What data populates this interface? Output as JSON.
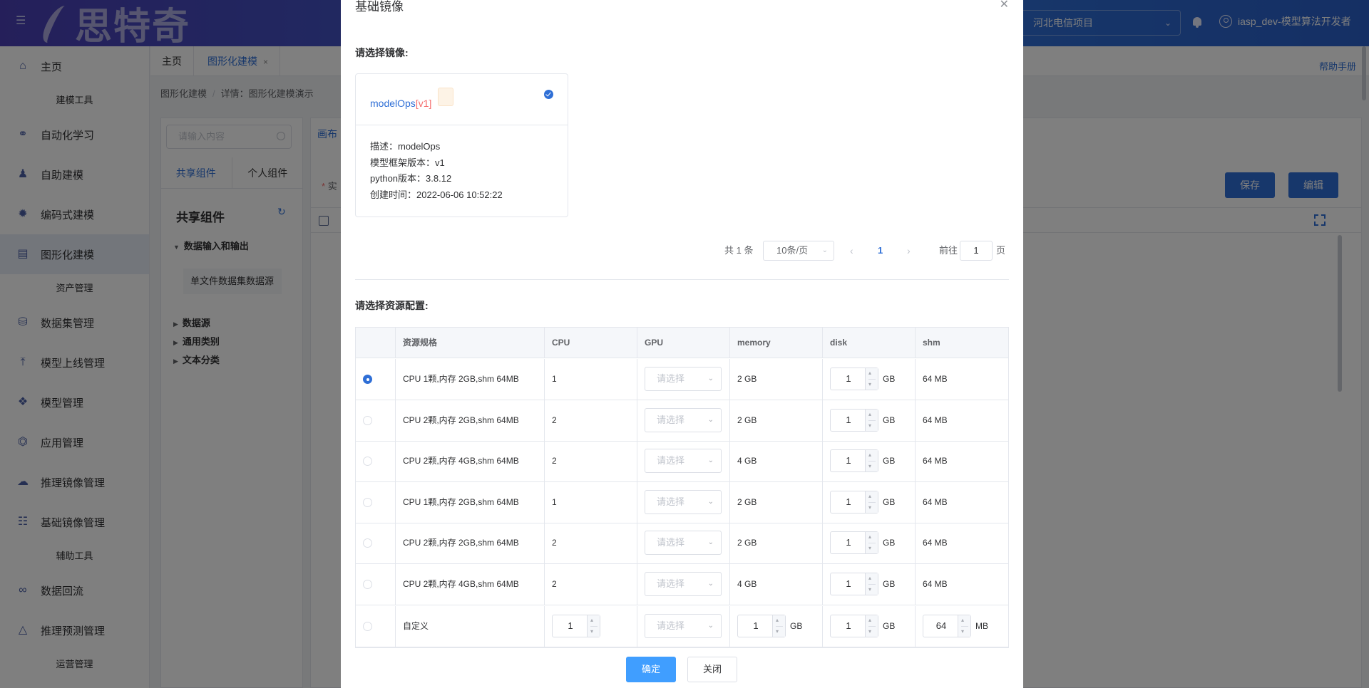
{
  "header": {
    "logo_text": "思特奇",
    "project": "河北电信项目",
    "user": "iasp_dev-模型算法开发者"
  },
  "sidebar": {
    "home": "主页",
    "group_modeling": "建模工具",
    "automl": "自动化学习",
    "self_modeling": "自助建模",
    "code_modeling": "编码式建模",
    "graph_modeling": "图形化建模",
    "group_assets": "资产管理",
    "dataset_mgmt": "数据集管理",
    "model_online": "模型上线管理",
    "model_mgmt": "模型管理",
    "app_mgmt": "应用管理",
    "infer_image_mgmt": "推理镜像管理",
    "base_image_mgmt": "基础镜像管理",
    "group_aux": "辅助工具",
    "data_backflow": "数据回流",
    "infer_predict_mgmt": "推理预测管理",
    "group_ops": "运营管理"
  },
  "tabs": {
    "home": "主页",
    "graph": "图形化建模",
    "help": "帮助手册"
  },
  "breadcrumb": {
    "root": "图形化建模",
    "sep": "/",
    "detail": "详情：图形化建模演示"
  },
  "left_panel": {
    "search_placeholder": "请输入内容",
    "tab_shared": "共享组件",
    "tab_personal": "个人组件",
    "title": "共享组件",
    "node_io": "数据输入和输出",
    "leaf_single_file": "单文件数据集数据源",
    "node_datasource": "数据源",
    "node_general": "通用类别",
    "node_text": "文本分类"
  },
  "canvas": {
    "tab": "画布",
    "required_mark": "*",
    "required_label": "实",
    "save": "保存",
    "edit": "编辑"
  },
  "modal": {
    "title": "基础镜像",
    "select_image_label": "请选择镜像:",
    "image_card": {
      "name": "modelOps",
      "version_open": "[",
      "version": "v1",
      "version_close": "]",
      "desc": "描述：modelOps",
      "framework": "模型框架版本：v1",
      "python": "python版本：3.8.12",
      "created": "创建时间：2022-06-06 10:52:22"
    },
    "pager": {
      "total": "共 1 条",
      "page_size": "10条/页",
      "prev": "‹",
      "current": "1",
      "next": "›",
      "goto_prefix": "前往",
      "goto_value": "1",
      "goto_suffix": "页"
    },
    "select_resource_label": "请选择资源配置:",
    "columns": [
      "资源规格",
      "CPU",
      "GPU",
      "memory",
      "disk",
      "shm"
    ],
    "gpu_placeholder": "请选择",
    "rows": [
      {
        "spec": "CPU 1颗,内存 2GB,shm 64MB",
        "cpu": "1",
        "memory": "2 GB",
        "disk": "1",
        "disk_unit": "GB",
        "shm": "64 MB",
        "selected": true
      },
      {
        "spec": "CPU 2颗,内存 2GB,shm 64MB",
        "cpu": "2",
        "memory": "2 GB",
        "disk": "1",
        "disk_unit": "GB",
        "shm": "64 MB",
        "selected": false
      },
      {
        "spec": "CPU 2颗,内存 4GB,shm 64MB",
        "cpu": "2",
        "memory": "4 GB",
        "disk": "1",
        "disk_unit": "GB",
        "shm": "64 MB",
        "selected": false
      },
      {
        "spec": "CPU 1颗,内存 2GB,shm 64MB",
        "cpu": "1",
        "memory": "2 GB",
        "disk": "1",
        "disk_unit": "GB",
        "shm": "64 MB",
        "selected": false
      },
      {
        "spec": "CPU 2颗,内存 2GB,shm 64MB",
        "cpu": "2",
        "memory": "2 GB",
        "disk": "1",
        "disk_unit": "GB",
        "shm": "64 MB",
        "selected": false
      },
      {
        "spec": "CPU 2颗,内存 4GB,shm 64MB",
        "cpu": "2",
        "memory": "4 GB",
        "disk": "1",
        "disk_unit": "GB",
        "shm": "64 MB",
        "selected": false
      }
    ],
    "custom_row": {
      "spec": "自定义",
      "cpu": "1",
      "memory": "1",
      "memory_unit": "GB",
      "disk": "1",
      "disk_unit": "GB",
      "shm": "64",
      "shm_unit": "MB"
    },
    "ok": "确定",
    "close": "关闭"
  },
  "colors": {
    "primary": "#2f6fd6",
    "ok_button": "#409eff",
    "version_red": "#f56c6c"
  }
}
